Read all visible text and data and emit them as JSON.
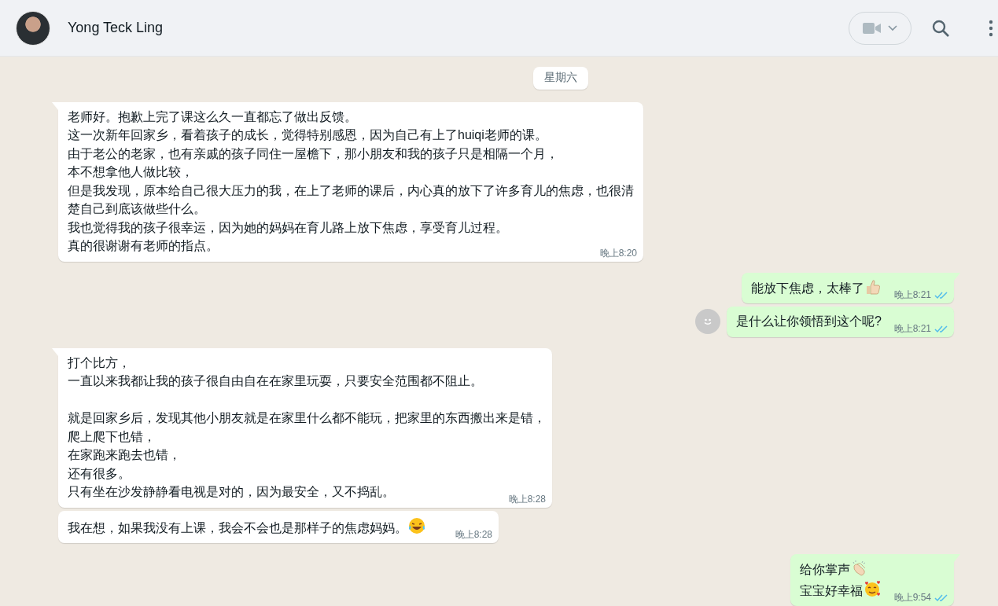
{
  "header": {
    "contact_name": "Yong Teck Ling"
  },
  "date_chip": "星期六",
  "messages": [
    {
      "outgoing": false,
      "tail": true,
      "time": "晚上8:20",
      "paragraphs": [
        [
          {
            "text": "老师好。抱歉上完了课这么久一直都忘了做出反馈。"
          },
          {
            "text": "这一次新年回家乡，看着孩子的成长，觉得特别感恩，因为自己有上了huiqi老师的课。"
          },
          {
            "text": "由于老公的老家，也有亲戚的孩子同住一屋檐下，那小朋友和我的孩子只是相隔一个月，"
          },
          {
            "text": "本不想拿他人做比较，"
          },
          {
            "text": "但是我发现，原本给自己很大压力的我，在上了老师的课后，内心真的放下了许多育儿的焦虑，也很清楚自己到底该做些什么。"
          },
          {
            "text": "我也觉得我的孩子很幸运，因为她的妈妈在育儿路上放下焦虑，享受育儿过程。"
          },
          {
            "text": "真的很谢谢有老师的指点。"
          }
        ]
      ]
    },
    {
      "outgoing": true,
      "tail": true,
      "time": "晚上8:21",
      "read": true,
      "paragraphs": [
        [
          {
            "text": "能放下焦虑，太棒了",
            "kind": "thumbs_up"
          }
        ]
      ]
    },
    {
      "outgoing": true,
      "tail": false,
      "time": "晚上8:21",
      "read": true,
      "reaction_button": true,
      "paragraphs": [
        [
          {
            "text": "是什么让你领悟到这个呢?"
          }
        ]
      ]
    },
    {
      "outgoing": false,
      "tail": true,
      "time": "晚上8:28",
      "paragraphs": [
        [
          {
            "text": "打个比方，"
          },
          {
            "text": "一直以来我都让我的孩子很自由自在在家里玩耍，只要安全范围都不阻止。"
          }
        ],
        [
          {
            "text": "就是回家乡后，发现其他小朋友就是在家里什么都不能玩，把家里的东西搬出来是错，"
          },
          {
            "text": "爬上爬下也错，"
          },
          {
            "text": "在家跑来跑去也错，"
          },
          {
            "text": "还有很多。"
          },
          {
            "text": "只有坐在沙发静静看电视是对的，因为最安全，又不捣乱。"
          }
        ]
      ]
    },
    {
      "outgoing": false,
      "tail": false,
      "time": "晚上8:28",
      "paragraphs": [
        [
          {
            "text": "我在想，如果我没有上课，我会不会也是那样子的焦虑妈妈。",
            "kind": "laughing"
          }
        ]
      ]
    },
    {
      "outgoing": true,
      "tail": true,
      "time": "晚上9:54",
      "read": true,
      "paragraphs": [
        [
          {
            "text": "给你掌声",
            "kind": "clapping"
          },
          {
            "text": "宝宝好幸福",
            "kind": "hearts_smile"
          }
        ]
      ]
    }
  ]
}
